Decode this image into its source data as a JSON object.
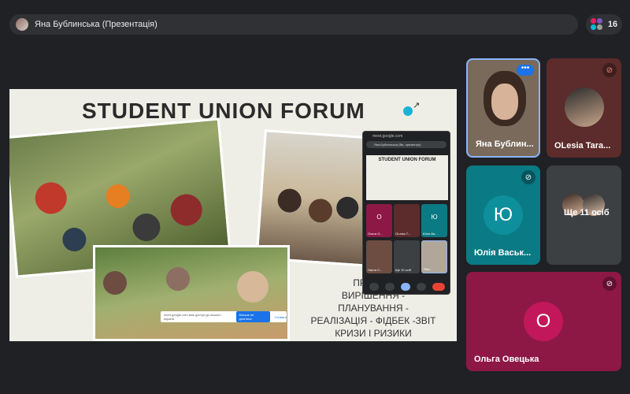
{
  "topbar": {
    "title": "Яна Бублинська (Презентація)"
  },
  "participants": {
    "count": "16"
  },
  "slide": {
    "title": "STUDENT UNION FORUM",
    "text_lines": [
      "ПРОБЛ...",
      "ВИРІШЕННЯ -",
      "ПЛАНУВАННЯ -",
      "РЕАЛІЗАЦІЯ - ФІДБЕК -ЗВІТ",
      "КРИЗИ І РИЗИКИ"
    ],
    "share_notice": "meet.google.com має доступ до вашого екрана.",
    "share_stop": "Більше не ділитися",
    "share_hide": "Сховати"
  },
  "mini_window": {
    "url": "meet.google.com",
    "bar_title": "Яна Бублинська (Ви, презентує)",
    "slide_title": "STUDENT UNION FORUM",
    "tiles": [
      {
        "label": "Ольга О...",
        "letter": "О"
      },
      {
        "label": "OLesia T..."
      },
      {
        "label": "Юлія Ва...",
        "letter": "Ю"
      },
      {
        "label": "Настя С..."
      },
      {
        "label": "Ще 10 осіб"
      },
      {
        "label": "Яна..."
      }
    ]
  },
  "tiles": [
    {
      "name": "Яна Бублин...",
      "type": "video"
    },
    {
      "name": "OLesia Tara...",
      "type": "avatar"
    },
    {
      "name": "Юлія Васьк...",
      "letter": "Ю",
      "type": "letter"
    },
    {
      "name": "Ще 11 осіб",
      "type": "group"
    },
    {
      "name": "Ольга Овецька",
      "letter": "О",
      "type": "letter"
    }
  ],
  "colors": {
    "accent": "#1a73e8",
    "tile_teal": "#0a7a85",
    "tile_pink": "#8e1845",
    "tile_dark": "#3c4043"
  }
}
